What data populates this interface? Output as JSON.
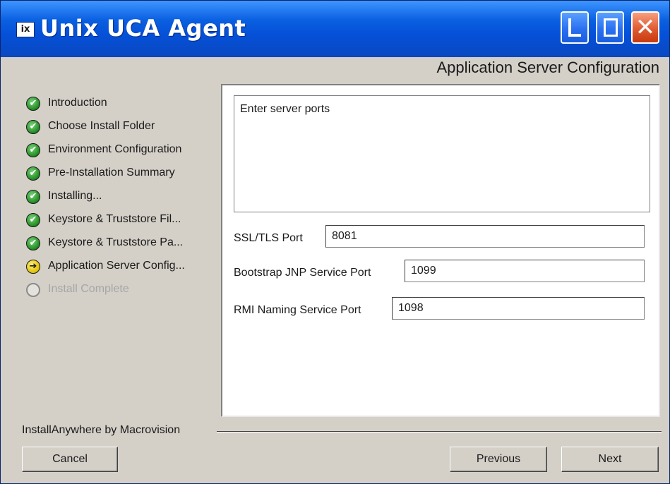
{
  "window": {
    "title": "Unix UCA  Agent",
    "logo_text": "ix",
    "buttons": {
      "minimize": "minimize",
      "maximize": "maximize",
      "close": "close"
    }
  },
  "header": {
    "caption": "Application Server  Configuration"
  },
  "steps": [
    {
      "label": "Introduction",
      "state": "done"
    },
    {
      "label": "Choose Install Folder",
      "state": "done"
    },
    {
      "label": "Environment Configuration",
      "state": "done"
    },
    {
      "label": "Pre-Installation Summary",
      "state": "done"
    },
    {
      "label": "Installing...",
      "state": "done"
    },
    {
      "label": "Keystore & Truststore Fil...",
      "state": "done"
    },
    {
      "label": "Keystore & Truststore Pa...",
      "state": "done"
    },
    {
      "label": "Application Server  Config...",
      "state": "current"
    },
    {
      "label": "Install Complete",
      "state": "pending"
    }
  ],
  "content": {
    "description": "Enter server ports",
    "fields": {
      "ssl_tls_port": {
        "label": "SSL/TLS Port",
        "value": "8081"
      },
      "bootstrap_jnp_port": {
        "label": "Bootstrap JNP Service Port",
        "value": "1099"
      },
      "rmi_naming_port": {
        "label": "RMI Naming Service Port",
        "value": "1098"
      }
    }
  },
  "footer": {
    "brand": "InstallAnywhere by Macrovision",
    "cancel_label": "Cancel",
    "previous_label": "Previous",
    "next_label": "Next"
  },
  "icons": {
    "done": "check-circle-icon",
    "current": "arrow-right-circle-icon",
    "pending": "empty-circle-icon"
  },
  "colors": {
    "title_bar": "#0a5fe0",
    "done_icon": "#1f8a1f",
    "current_icon": "#e0c000",
    "pending_text": "#a6a6a6"
  }
}
